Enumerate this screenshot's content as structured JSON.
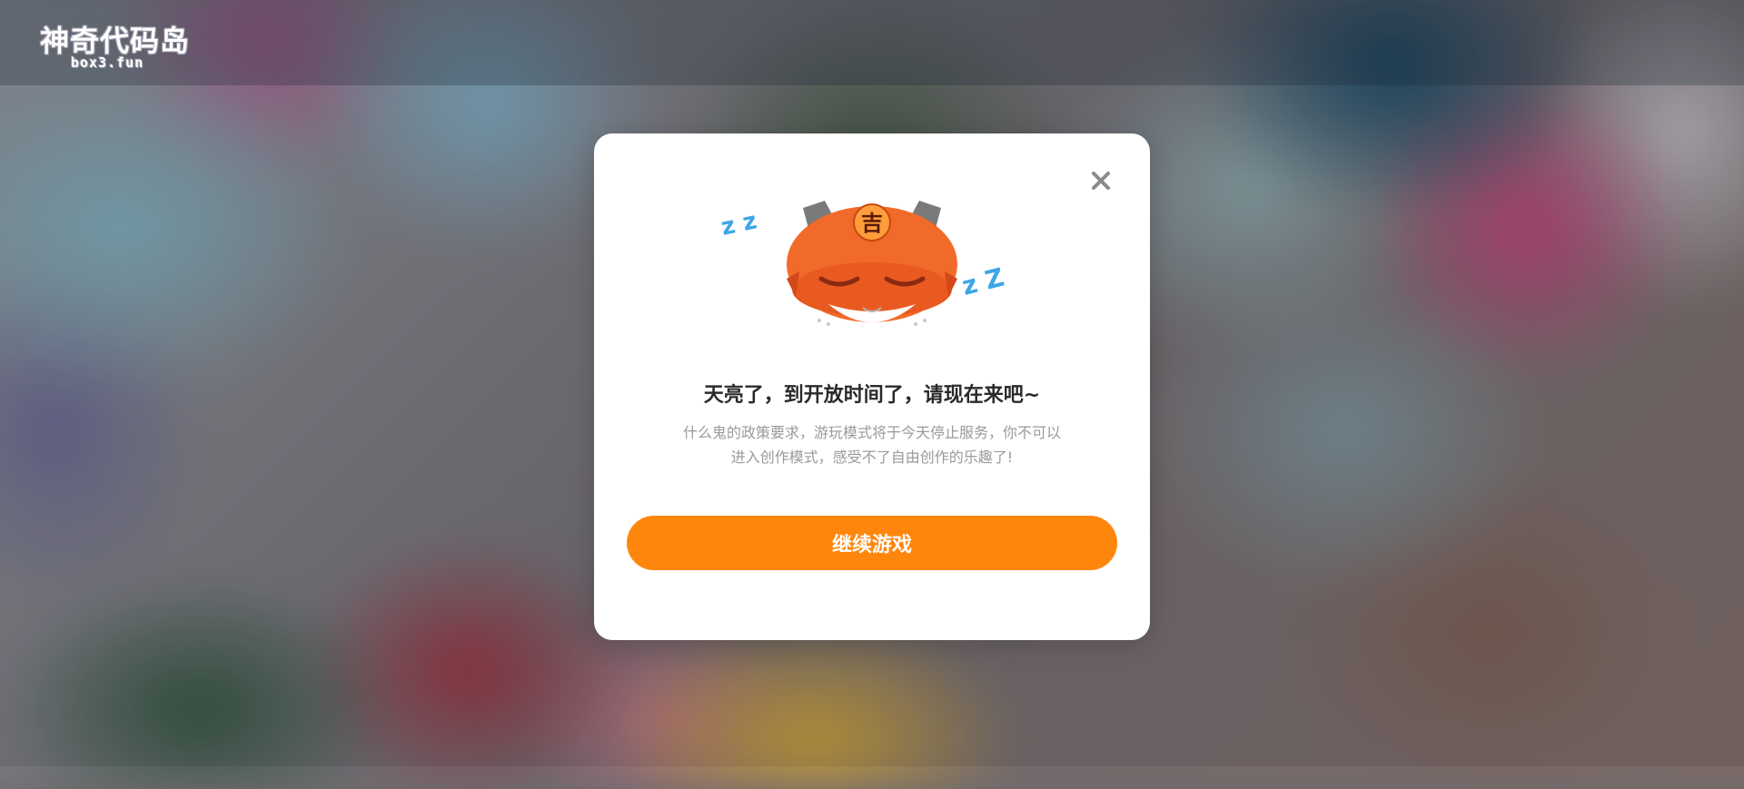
{
  "header": {
    "logo_text": "神奇代码岛",
    "logo_subtext": "box3.fun"
  },
  "modal": {
    "close_icon": "close-icon",
    "mascot_badge": "吉",
    "mascot_zz_left": "z z",
    "mascot_zz_right": "z Z",
    "title": "天亮了，到开放时间了，请现在来吧~",
    "description_line1": "什么鬼的政策要求，游玩模式将于今天停止服务，你不可以",
    "description_line2": "进入创作模式，感受不了自由创作的乐趣了!",
    "continue_button": "继续游戏"
  },
  "colors": {
    "accent": "#ff860d",
    "mascot_orange": "#f26a2a",
    "zz_blue": "#3ea6e6",
    "close_gray": "#8a8a8a"
  }
}
